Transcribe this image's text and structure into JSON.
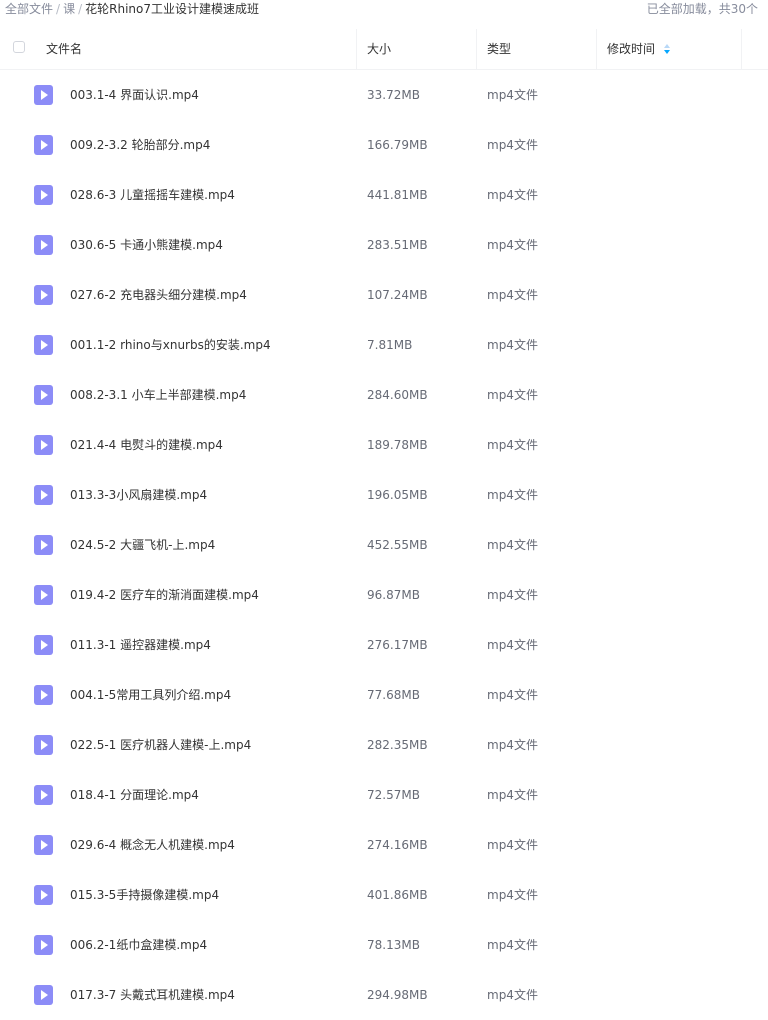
{
  "breadcrumb": {
    "items": [
      "全部文件",
      "课"
    ],
    "separator": "/",
    "current": "花轮Rhino7工业设计建模速成班"
  },
  "load_status": "已全部加载，共30个",
  "table": {
    "columns": {
      "name": "文件名",
      "size": "大小",
      "type": "类型",
      "modified": "修改时间"
    },
    "sort_column": "modified",
    "rows": [
      {
        "name": "003.1-4 界面认识.mp4",
        "size": "33.72MB",
        "type": "mp4文件"
      },
      {
        "name": "009.2-3.2 轮胎部分.mp4",
        "size": "166.79MB",
        "type": "mp4文件"
      },
      {
        "name": "028.6-3 儿童摇摇车建模.mp4",
        "size": "441.81MB",
        "type": "mp4文件"
      },
      {
        "name": "030.6-5 卡通小熊建模.mp4",
        "size": "283.51MB",
        "type": "mp4文件"
      },
      {
        "name": "027.6-2 充电器头细分建模.mp4",
        "size": "107.24MB",
        "type": "mp4文件"
      },
      {
        "name": "001.1-2 rhino与xnurbs的安装.mp4",
        "size": "7.81MB",
        "type": "mp4文件"
      },
      {
        "name": "008.2-3.1 小车上半部建模.mp4",
        "size": "284.60MB",
        "type": "mp4文件"
      },
      {
        "name": "021.4-4 电熨斗的建模.mp4",
        "size": "189.78MB",
        "type": "mp4文件"
      },
      {
        "name": "013.3-3小风扇建模.mp4",
        "size": "196.05MB",
        "type": "mp4文件"
      },
      {
        "name": "024.5-2 大疆飞机-上.mp4",
        "size": "452.55MB",
        "type": "mp4文件"
      },
      {
        "name": "019.4-2 医疗车的渐消面建模.mp4",
        "size": "96.87MB",
        "type": "mp4文件"
      },
      {
        "name": "011.3-1 遥控器建模.mp4",
        "size": "276.17MB",
        "type": "mp4文件"
      },
      {
        "name": "004.1-5常用工具列介绍.mp4",
        "size": "77.68MB",
        "type": "mp4文件"
      },
      {
        "name": "022.5-1 医疗机器人建模-上.mp4",
        "size": "282.35MB",
        "type": "mp4文件"
      },
      {
        "name": "018.4-1 分面理论.mp4",
        "size": "72.57MB",
        "type": "mp4文件"
      },
      {
        "name": "029.6-4 概念无人机建模.mp4",
        "size": "274.16MB",
        "type": "mp4文件"
      },
      {
        "name": "015.3-5手持摄像建模.mp4",
        "size": "401.86MB",
        "type": "mp4文件"
      },
      {
        "name": "006.2-1纸巾盒建模.mp4",
        "size": "78.13MB",
        "type": "mp4文件"
      },
      {
        "name": "017.3-7 头戴式耳机建模.mp4",
        "size": "294.98MB",
        "type": "mp4文件"
      }
    ]
  },
  "colors": {
    "file_icon": "#8c8cf7",
    "sort_active": "#06a7ff",
    "muted_text": "#878c9c"
  },
  "icons": {
    "row_icon": "video-file-icon",
    "sort_icon": "sort-arrows-icon",
    "select_all": "checkbox"
  }
}
